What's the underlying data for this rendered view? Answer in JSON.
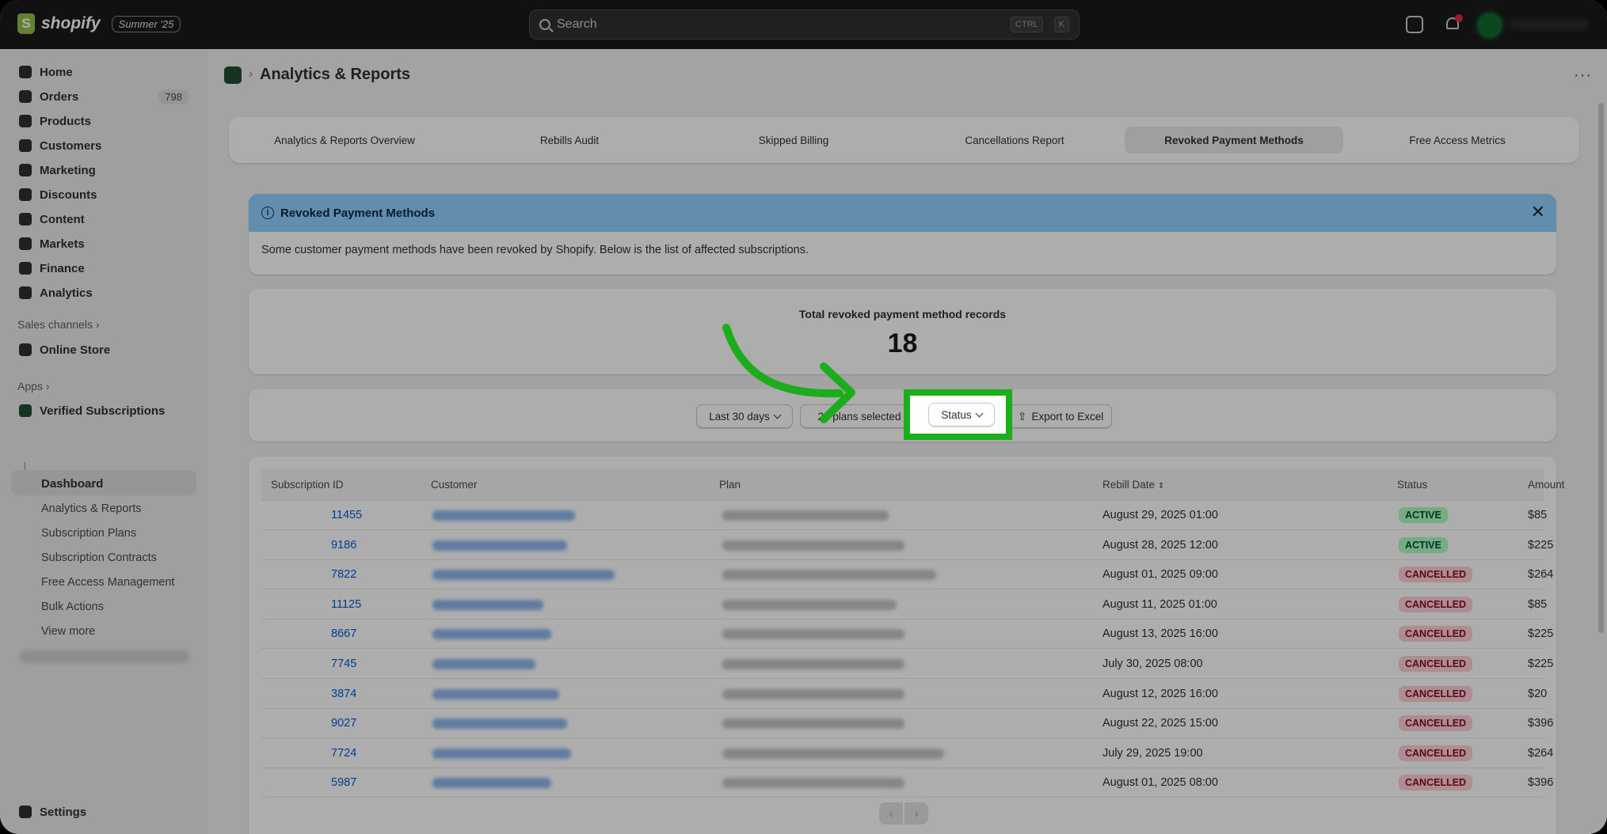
{
  "topbar": {
    "brand": "shopify",
    "edition_badge": "Summer '25",
    "search_placeholder": "Search",
    "shortcut_ctrl": "CTRL",
    "shortcut_key": "K"
  },
  "sidebar": {
    "items": [
      {
        "label": "Home",
        "icon": "home-icon"
      },
      {
        "label": "Orders",
        "icon": "inbox-icon",
        "count": "798"
      },
      {
        "label": "Products",
        "icon": "tag-icon"
      },
      {
        "label": "Customers",
        "icon": "person-icon"
      },
      {
        "label": "Marketing",
        "icon": "target-icon"
      },
      {
        "label": "Discounts",
        "icon": "discount-icon"
      },
      {
        "label": "Content",
        "icon": "content-icon"
      },
      {
        "label": "Markets",
        "icon": "globe-icon"
      },
      {
        "label": "Finance",
        "icon": "bank-icon"
      },
      {
        "label": "Analytics",
        "icon": "bar-chart-icon"
      }
    ],
    "sales_channels_title": "Sales channels",
    "online_store": "Online Store",
    "apps_title": "Apps",
    "app_name": "Verified Subscriptions",
    "app_sub_active": "Dashboard",
    "app_sub_items": [
      "Analytics & Reports",
      "Subscription Plans",
      "Subscription Contracts",
      "Free Access Management",
      "Bulk Actions",
      "View more"
    ],
    "settings": "Settings"
  },
  "page": {
    "title": "Analytics & Reports",
    "tabs": [
      "Analytics & Reports Overview",
      "Rebills Audit",
      "Skipped Billing",
      "Cancellations Report",
      "Revoked Payment Methods",
      "Free Access Metrics"
    ],
    "active_tab": "Revoked Payment Methods"
  },
  "banner": {
    "title": "Revoked Payment Methods",
    "text": "Some customer payment methods have been revoked by Shopify. Below is the list of affected subscriptions."
  },
  "stat": {
    "label": "Total revoked payment method records",
    "value": "18"
  },
  "filters": {
    "date_range": "Last 30 days",
    "plans": "20 plans selected",
    "status": "Status",
    "export": "Export to Excel"
  },
  "table": {
    "columns": [
      "Subscription ID",
      "Customer",
      "Plan",
      "Rebill Date",
      "Status",
      "Amount"
    ],
    "rows": [
      {
        "id": "11455",
        "rebill_date": "August 29, 2025 01:00",
        "status": "ACTIVE",
        "amount": "$85"
      },
      {
        "id": "9186",
        "rebill_date": "August 28, 2025 12:00",
        "status": "ACTIVE",
        "amount": "$225"
      },
      {
        "id": "7822",
        "rebill_date": "August 01, 2025 09:00",
        "status": "CANCELLED",
        "amount": "$264"
      },
      {
        "id": "11125",
        "rebill_date": "August 11, 2025 01:00",
        "status": "CANCELLED",
        "amount": "$85"
      },
      {
        "id": "8667",
        "rebill_date": "August 13, 2025 16:00",
        "status": "CANCELLED",
        "amount": "$225"
      },
      {
        "id": "7745",
        "rebill_date": "July 30, 2025 08:00",
        "status": "CANCELLED",
        "amount": "$225"
      },
      {
        "id": "3874",
        "rebill_date": "August 12, 2025 16:00",
        "status": "CANCELLED",
        "amount": "$20"
      },
      {
        "id": "9027",
        "rebill_date": "August 22, 2025 15:00",
        "status": "CANCELLED",
        "amount": "$396"
      },
      {
        "id": "7724",
        "rebill_date": "July 29, 2025 19:00",
        "status": "CANCELLED",
        "amount": "$264"
      },
      {
        "id": "5987",
        "rebill_date": "August 01, 2025 08:00",
        "status": "CANCELLED",
        "amount": "$396"
      }
    ]
  },
  "colors": {
    "highlight": "#1cad1c",
    "banner": "#91d0ff",
    "active_badge": "#affebf",
    "cancelled_badge": "#fed1d7"
  }
}
